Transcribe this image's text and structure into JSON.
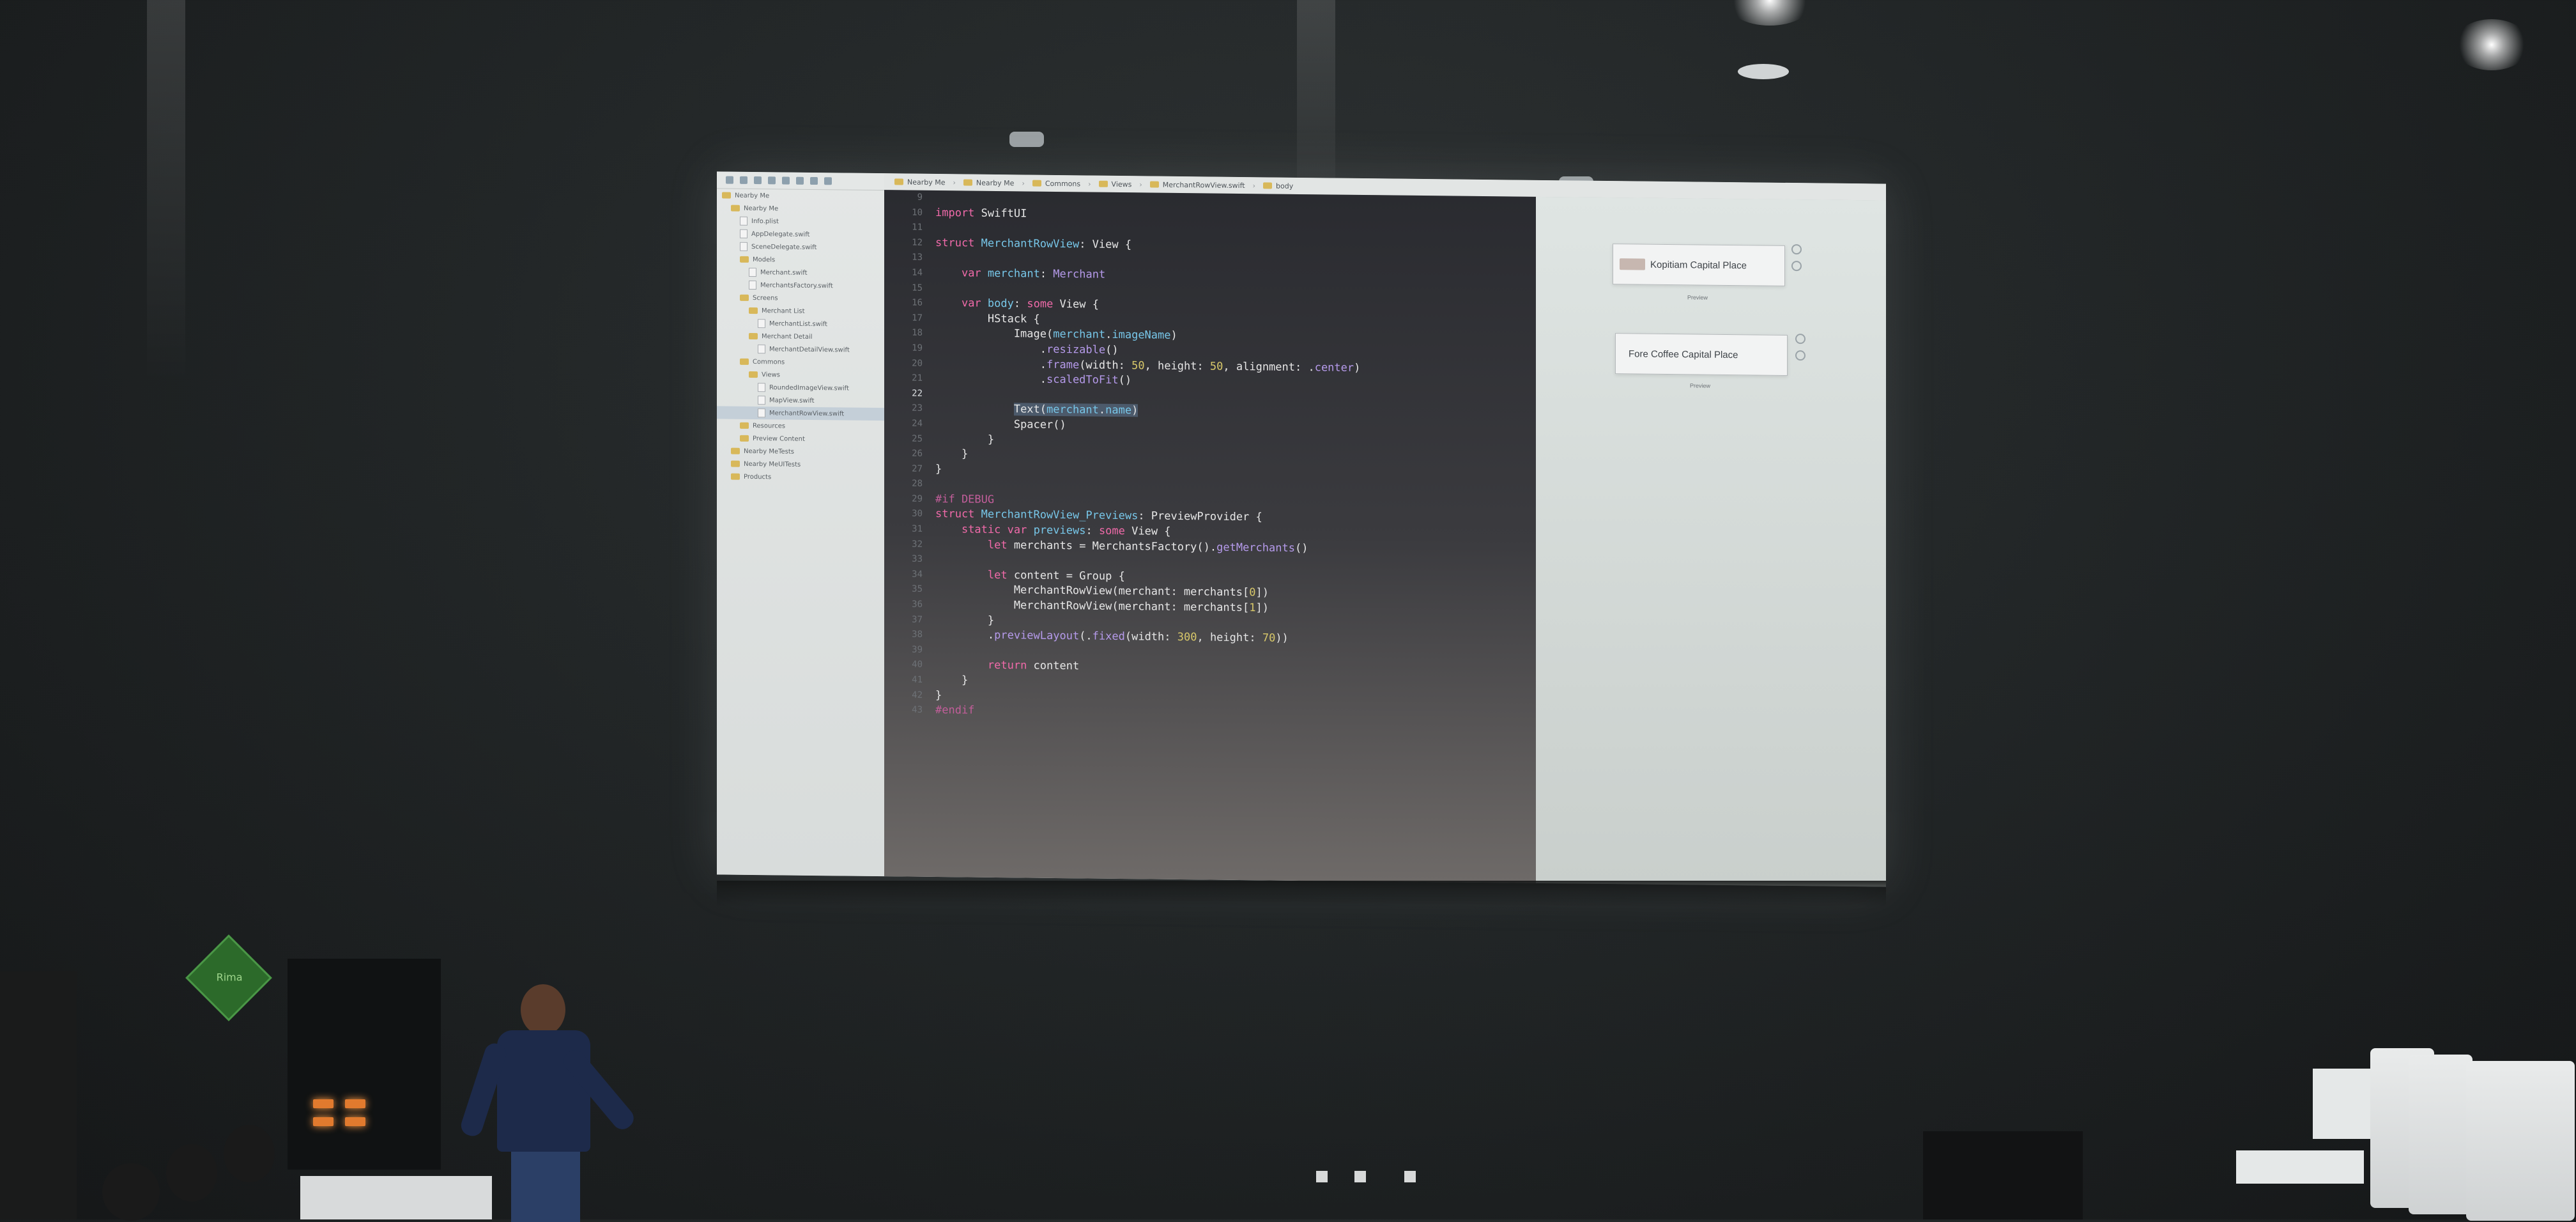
{
  "scene": "Speaker presenting Swift code on a projection screen",
  "navigator": {
    "items": [
      {
        "label": "Nearby Me",
        "kind": "project",
        "indent": 0
      },
      {
        "label": "Nearby Me",
        "kind": "folder",
        "indent": 1
      },
      {
        "label": "Info.plist",
        "kind": "file",
        "indent": 2
      },
      {
        "label": "AppDelegate.swift",
        "kind": "file",
        "indent": 2
      },
      {
        "label": "SceneDelegate.swift",
        "kind": "file",
        "indent": 2
      },
      {
        "label": "Models",
        "kind": "folder",
        "indent": 2
      },
      {
        "label": "Merchant.swift",
        "kind": "file",
        "indent": 3
      },
      {
        "label": "MerchantsFactory.swift",
        "kind": "file",
        "indent": 3
      },
      {
        "label": "Screens",
        "kind": "folder",
        "indent": 2
      },
      {
        "label": "Merchant List",
        "kind": "folder",
        "indent": 3
      },
      {
        "label": "MerchantList.swift",
        "kind": "file",
        "indent": 4
      },
      {
        "label": "Merchant Detail",
        "kind": "folder",
        "indent": 3
      },
      {
        "label": "MerchantDetailView.swift",
        "kind": "file",
        "indent": 4
      },
      {
        "label": "Commons",
        "kind": "folder",
        "indent": 2
      },
      {
        "label": "Views",
        "kind": "folder",
        "indent": 3
      },
      {
        "label": "RoundedImageView.swift",
        "kind": "file",
        "indent": 4
      },
      {
        "label": "MapView.swift",
        "kind": "file",
        "indent": 4
      },
      {
        "label": "MerchantRowView.swift",
        "kind": "file",
        "indent": 4,
        "selected": true
      },
      {
        "label": "Resources",
        "kind": "folder",
        "indent": 2
      },
      {
        "label": "Preview Content",
        "kind": "folder",
        "indent": 2
      },
      {
        "label": "Nearby MeTests",
        "kind": "folder",
        "indent": 1
      },
      {
        "label": "Nearby MeUITests",
        "kind": "folder",
        "indent": 1
      },
      {
        "label": "Products",
        "kind": "folder",
        "indent": 1
      }
    ]
  },
  "jumpbar": {
    "crumbs": [
      "Nearby Me",
      "Nearby Me",
      "Commons",
      "Views",
      "MerchantRowView.swift",
      "body"
    ]
  },
  "editor": {
    "current_line": 22,
    "lines": [
      {
        "n": "9",
        "html": ""
      },
      {
        "n": "10",
        "html": "<span class='kw'>import</span> SwiftUI"
      },
      {
        "n": "11",
        "html": ""
      },
      {
        "n": "12",
        "html": "<span class='kw'>struct</span> <span class='ty'>MerchantRowView</span>: View {"
      },
      {
        "n": "13",
        "html": ""
      },
      {
        "n": "14",
        "html": "    <span class='kw'>var</span> <span class='ty'>merchant</span>: <span class='fn'>Merchant</span>"
      },
      {
        "n": "15",
        "html": ""
      },
      {
        "n": "16",
        "html": "    <span class='kw'>var</span> <span class='ty'>body</span>: <span class='kw'>some</span> View {"
      },
      {
        "n": "17",
        "html": "        HStack {"
      },
      {
        "n": "18",
        "html": "            Image(<span class='ty'>merchant</span>.<span class='ty'>imageName</span>)"
      },
      {
        "n": "19",
        "html": "                .<span class='fn'>resizable</span>()"
      },
      {
        "n": "20",
        "html": "                .<span class='fn'>frame</span>(width: <span class='num'>50</span>, height: <span class='num'>50</span>, alignment: .<span class='fn'>center</span>)"
      },
      {
        "n": "21",
        "html": "                .<span class='fn'>scaledToFit</span>()"
      },
      {
        "n": "22",
        "html": ""
      },
      {
        "n": "23",
        "html": "            <span class='hl'>Text(<span class='ty'>merchant</span>.<span class='ty'>name</span>)</span>"
      },
      {
        "n": "24",
        "html": "            Spacer()"
      },
      {
        "n": "25",
        "html": "        }"
      },
      {
        "n": "26",
        "html": "    }"
      },
      {
        "n": "27",
        "html": "}"
      },
      {
        "n": "28",
        "html": ""
      },
      {
        "n": "29",
        "html": "<span class='cm'>#if DEBUG</span>"
      },
      {
        "n": "30",
        "html": "<span class='kw'>struct</span> <span class='ty'>MerchantRowView_Previews</span>: PreviewProvider {"
      },
      {
        "n": "31",
        "html": "    <span class='kw'>static var</span> <span class='ty'>previews</span>: <span class='kw'>some</span> View {"
      },
      {
        "n": "32",
        "html": "        <span class='kw'>let</span> merchants = MerchantsFactory().<span class='fn'>getMerchants</span>()"
      },
      {
        "n": "33",
        "html": ""
      },
      {
        "n": "34",
        "html": "        <span class='kw'>let</span> content = Group {"
      },
      {
        "n": "35",
        "html": "            MerchantRowView(merchant: merchants[<span class='num'>0</span>])"
      },
      {
        "n": "36",
        "html": "            MerchantRowView(merchant: merchants[<span class='num'>1</span>])"
      },
      {
        "n": "37",
        "html": "        }"
      },
      {
        "n": "38",
        "html": "        .<span class='fn'>previewLayout</span>(.<span class='fn'>fixed</span>(width: <span class='num'>300</span>, height: <span class='num'>70</span>))"
      },
      {
        "n": "39",
        "html": ""
      },
      {
        "n": "40",
        "html": "        <span class='kw'>return</span> content"
      },
      {
        "n": "41",
        "html": "    }"
      },
      {
        "n": "42",
        "html": "}"
      },
      {
        "n": "43",
        "html": "<span class='cm'>#endif</span>"
      }
    ]
  },
  "canvas": {
    "previews": [
      {
        "title": "Kopitiam Capital Place",
        "caption": "Preview"
      },
      {
        "title": "Fore Coffee Capital Place",
        "caption": "Preview"
      }
    ]
  },
  "stage": {
    "sign_text": "Rima"
  }
}
